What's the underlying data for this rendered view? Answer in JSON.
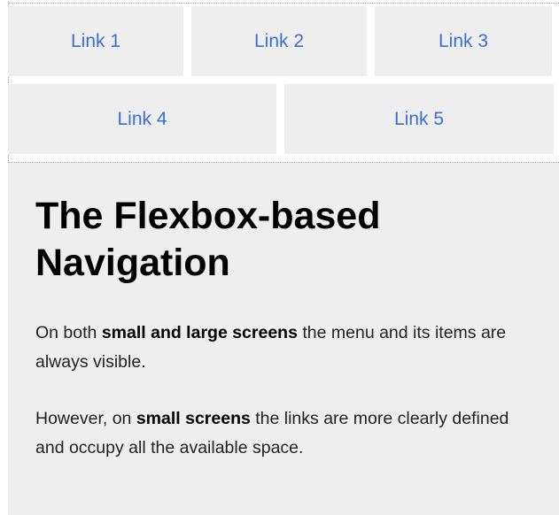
{
  "nav": {
    "links": [
      {
        "label": "Link 1"
      },
      {
        "label": "Link 2"
      },
      {
        "label": "Link 3"
      },
      {
        "label": "Link 4"
      },
      {
        "label": "Link 5"
      }
    ]
  },
  "main": {
    "title": "The Flexbox-based Navigation",
    "paragraph1": {
      "before": "On both ",
      "bold": "small and large screens",
      "after": " the menu and its items are always visible."
    },
    "paragraph2": {
      "before": "However, on ",
      "bold": "small screens",
      "after": " the links are more clearly defined and occupy all the available space."
    }
  },
  "colors": {
    "link": "#3b6fd1",
    "tile_background": "#eeeeee",
    "content_background": "#eeeeee"
  }
}
